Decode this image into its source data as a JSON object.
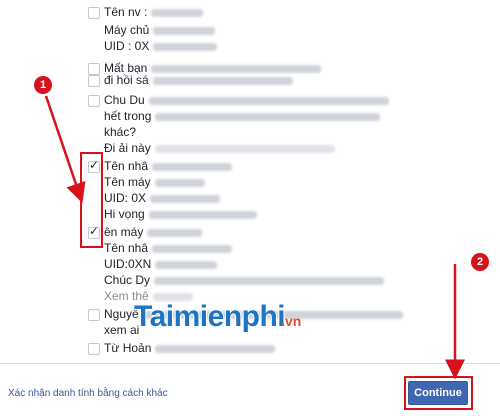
{
  "items": [
    {
      "checked": false,
      "lines": [
        "Tên nv :",
        "Máy chủ",
        "UID : 0X"
      ]
    },
    {
      "checked": false,
      "lines": [
        "Mất bạn"
      ]
    },
    {
      "checked": false,
      "lines": [
        "đi hồi sá"
      ]
    },
    {
      "checked": false,
      "lines": [
        "Chu Du",
        "hết trong",
        "khác?"
      ]
    },
    {
      "checked": false,
      "lines": [
        "Đi ải này"
      ]
    },
    {
      "checked": true,
      "lines": [
        "Tên nhâ",
        "Tên máy",
        "UID: 0X",
        "Hi vọng"
      ]
    },
    {
      "checked": true,
      "lines": [
        "ên máy",
        "Tên nhâ",
        "UID:0XN",
        "Chúc Dy",
        "Xem thê"
      ]
    },
    {
      "checked": false,
      "lines": [
        "Nguyễ",
        "xem ai"
      ]
    },
    {
      "checked": false,
      "lines": [
        "Từ Hoản"
      ]
    }
  ],
  "footer": {
    "alt_link": "Xác nhận danh tính bằng cách khác",
    "continue_label": "Continue"
  },
  "annotations": {
    "step1": "1",
    "step2": "2",
    "accent_color": "#d6121c"
  },
  "watermark": {
    "main": "Taimienphi",
    "suffix": ".vn"
  },
  "colors": {
    "button_bg": "#4267b2",
    "link": "#365899"
  }
}
